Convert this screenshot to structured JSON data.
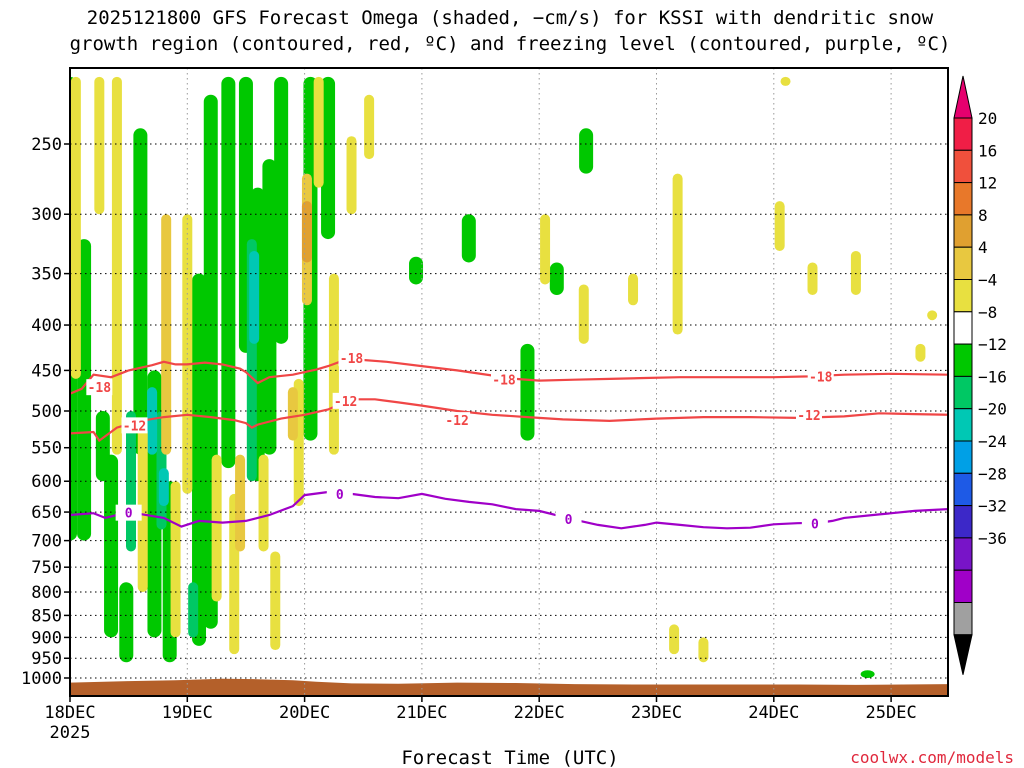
{
  "chart_data": {
    "type": "contour",
    "title_line1": "2025121800 GFS Forecast Omega (shaded, −cm/s) for KSSI with dendritic snow",
    "title_line2": "growth region (contoured, red, ºC) and freezing level (contoured, purple, ºC)",
    "xlabel": "Forecast Time (UTC)",
    "ylabel": "",
    "credit": "coolwx.com/models",
    "x_unit": "days since 18DEC 2025 00Z",
    "xlim": [
      0,
      7.49
    ],
    "x_ticks": [
      {
        "x": 0,
        "label": "18DEC",
        "sub": "2025"
      },
      {
        "x": 1,
        "label": "19DEC"
      },
      {
        "x": 2,
        "label": "20DEC"
      },
      {
        "x": 3,
        "label": "21DEC"
      },
      {
        "x": 4,
        "label": "22DEC"
      },
      {
        "x": 5,
        "label": "23DEC"
      },
      {
        "x": 6,
        "label": "24DEC"
      },
      {
        "x": 7,
        "label": "25DEC"
      }
    ],
    "y_scale": "log-pressure",
    "ylim_hpa": [
      207,
      1035
    ],
    "y_ticks": [
      250,
      300,
      350,
      400,
      450,
      500,
      550,
      600,
      650,
      700,
      750,
      800,
      850,
      900,
      950,
      1000
    ],
    "grid": true,
    "colorbar": {
      "labels": [
        "20",
        "16",
        "12",
        "8",
        "4",
        "−4",
        "−8",
        "−12",
        "−16",
        "−20",
        "−24",
        "−28",
        "−32",
        "−36"
      ],
      "bins": [
        "#f01e46",
        "#f0503c",
        "#e8782a",
        "#e0a030",
        "#e8c840",
        "#e8e040",
        "#ffffff",
        "#00c800",
        "#00c864",
        "#00c8b4",
        "#00a0e6",
        "#1e5ae6",
        "#3c28c8",
        "#7814c8",
        "#a000c8",
        "#a0a0a0"
      ],
      "top_color": "#e6006e",
      "bottom_color": "#000000"
    },
    "series": [
      {
        "label": "-18",
        "color": "#f04646",
        "points": [
          [
            0,
            478
          ],
          [
            0.1,
            472
          ],
          [
            0.2,
            455
          ],
          [
            0.35,
            458
          ],
          [
            0.5,
            450
          ],
          [
            0.7,
            444
          ],
          [
            0.8,
            440
          ],
          [
            0.9,
            443
          ],
          [
            1.0,
            443
          ],
          [
            1.15,
            441
          ],
          [
            1.3,
            443
          ],
          [
            1.45,
            448
          ],
          [
            1.5,
            452
          ],
          [
            1.6,
            465
          ],
          [
            1.7,
            458
          ],
          [
            1.9,
            455
          ],
          [
            2.0,
            452
          ],
          [
            2.1,
            449
          ],
          [
            2.2,
            445
          ],
          [
            2.3,
            440
          ],
          [
            2.4,
            437
          ],
          [
            2.5,
            438
          ],
          [
            2.7,
            440
          ],
          [
            3.0,
            445
          ],
          [
            3.3,
            450
          ],
          [
            3.6,
            456
          ],
          [
            3.8,
            460
          ],
          [
            4.0,
            462
          ],
          [
            4.3,
            461
          ],
          [
            4.6,
            460
          ],
          [
            4.9,
            459
          ],
          [
            5.2,
            458
          ],
          [
            5.5,
            458
          ],
          [
            6.0,
            458
          ],
          [
            6.3,
            457
          ],
          [
            6.6,
            455
          ],
          [
            7.0,
            454
          ],
          [
            7.49,
            455
          ]
        ],
        "label_positions": [
          [
            0.25,
            470
          ],
          [
            2.4,
            436
          ],
          [
            3.7,
            461
          ],
          [
            6.4,
            457
          ]
        ]
      },
      {
        "label": "-12",
        "color": "#f04646",
        "points": [
          [
            0,
            530
          ],
          [
            0.2,
            528
          ],
          [
            0.25,
            540
          ],
          [
            0.4,
            522
          ],
          [
            0.6,
            513
          ],
          [
            0.8,
            508
          ],
          [
            1.0,
            505
          ],
          [
            1.2,
            508
          ],
          [
            1.4,
            512
          ],
          [
            1.5,
            516
          ],
          [
            1.55,
            522
          ],
          [
            1.6,
            518
          ],
          [
            1.8,
            510
          ],
          [
            2.0,
            505
          ],
          [
            2.2,
            498
          ],
          [
            2.4,
            485
          ],
          [
            2.6,
            485
          ],
          [
            2.8,
            489
          ],
          [
            3.0,
            493
          ],
          [
            3.3,
            500
          ],
          [
            3.6,
            505
          ],
          [
            3.9,
            508
          ],
          [
            4.2,
            511
          ],
          [
            4.4,
            512
          ],
          [
            4.6,
            513
          ],
          [
            5.0,
            510
          ],
          [
            5.4,
            508
          ],
          [
            5.8,
            508
          ],
          [
            6.2,
            509
          ],
          [
            6.6,
            507
          ],
          [
            6.9,
            503
          ],
          [
            7.2,
            504
          ],
          [
            7.49,
            505
          ]
        ],
        "label_positions": [
          [
            0.55,
            519
          ],
          [
            2.35,
            487
          ],
          [
            3.3,
            512
          ],
          [
            6.3,
            505
          ]
        ]
      },
      {
        "label": "0",
        "color": "#a000c8",
        "points": [
          [
            0,
            655
          ],
          [
            0.2,
            652
          ],
          [
            0.3,
            660
          ],
          [
            0.5,
            650
          ],
          [
            0.8,
            660
          ],
          [
            0.95,
            675
          ],
          [
            1.1,
            665
          ],
          [
            1.3,
            668
          ],
          [
            1.5,
            665
          ],
          [
            1.7,
            655
          ],
          [
            1.9,
            640
          ],
          [
            2.0,
            622
          ],
          [
            2.2,
            617
          ],
          [
            2.4,
            620
          ],
          [
            2.6,
            625
          ],
          [
            2.8,
            627
          ],
          [
            3.0,
            620
          ],
          [
            3.2,
            628
          ],
          [
            3.4,
            633
          ],
          [
            3.6,
            637
          ],
          [
            3.8,
            645
          ],
          [
            4.0,
            648
          ],
          [
            4.3,
            663
          ],
          [
            4.5,
            672
          ],
          [
            4.7,
            678
          ],
          [
            4.9,
            672
          ],
          [
            5.0,
            668
          ],
          [
            5.2,
            672
          ],
          [
            5.4,
            676
          ],
          [
            5.6,
            678
          ],
          [
            5.8,
            677
          ],
          [
            6.0,
            671
          ],
          [
            6.2,
            669
          ],
          [
            6.4,
            668
          ],
          [
            6.5,
            665
          ],
          [
            6.6,
            660
          ],
          [
            6.9,
            654
          ],
          [
            7.2,
            648
          ],
          [
            7.49,
            645
          ]
        ],
        "label_positions": [
          [
            0.5,
            651
          ],
          [
            2.3,
            620
          ],
          [
            4.25,
            662
          ],
          [
            6.35,
            670
          ]
        ]
      }
    ],
    "shaded_regions": [
      {
        "bin": "-8",
        "x": 0.0,
        "p0": 210,
        "p1": 700
      },
      {
        "bin": "-8",
        "x": 0.12,
        "p0": 320,
        "p1": 700
      },
      {
        "bin": "-8",
        "x": 0.35,
        "p0": 560,
        "p1": 900
      },
      {
        "bin": "-8",
        "x": 0.48,
        "p0": 780,
        "p1": 960
      },
      {
        "bin": "-8",
        "x": 0.6,
        "p0": 240,
        "p1": 560
      },
      {
        "bin": "-8",
        "x": 0.72,
        "p0": 450,
        "p1": 900
      },
      {
        "bin": "-8",
        "x": 0.85,
        "p0": 600,
        "p1": 960
      },
      {
        "bin": "-8",
        "x": 1.1,
        "p0": 350,
        "p1": 920
      },
      {
        "bin": "-8",
        "x": 1.2,
        "p0": 220,
        "p1": 880
      },
      {
        "bin": "-8",
        "x": 1.35,
        "p0": 210,
        "p1": 580
      },
      {
        "bin": "-8",
        "x": 1.5,
        "p0": 210,
        "p1": 430
      },
      {
        "bin": "-8",
        "x": 1.6,
        "p0": 280,
        "p1": 600
      },
      {
        "bin": "-8",
        "x": 1.7,
        "p0": 260,
        "p1": 560
      },
      {
        "bin": "-8",
        "x": 1.8,
        "p0": 210,
        "p1": 420
      },
      {
        "bin": "-8",
        "x": 2.05,
        "p0": 210,
        "p1": 540
      },
      {
        "bin": "-8",
        "x": 2.2,
        "p0": 210,
        "p1": 320
      },
      {
        "bin": "-8",
        "x": 0.28,
        "p0": 500,
        "p1": 600
      },
      {
        "bin": "-8",
        "x": 3.9,
        "p0": 420,
        "p1": 540
      },
      {
        "bin": "-8",
        "x": 3.4,
        "p0": 300,
        "p1": 340
      },
      {
        "bin": "-8",
        "x": 2.95,
        "p0": 335,
        "p1": 360
      },
      {
        "bin": "-8",
        "x": 4.15,
        "p0": 340,
        "p1": 370
      },
      {
        "bin": "-8",
        "x": 4.4,
        "p0": 240,
        "p1": 270
      },
      {
        "bin": "-8",
        "x": 6.8,
        "p0": 980,
        "p1": 1000
      },
      {
        "bin": "-12",
        "x": 0.02,
        "p0": 300,
        "p1": 420
      },
      {
        "bin": "-12",
        "x": 0.52,
        "p0": 500,
        "p1": 720
      },
      {
        "bin": "-12",
        "x": 0.78,
        "p0": 500,
        "p1": 680
      },
      {
        "bin": "-12",
        "x": 1.05,
        "p0": 780,
        "p1": 900
      },
      {
        "bin": "-12",
        "x": 1.55,
        "p0": 320,
        "p1": 600
      },
      {
        "bin": "-16",
        "x": 0.7,
        "p0": 470,
        "p1": 560
      },
      {
        "bin": "-16",
        "x": 0.8,
        "p0": 580,
        "p1": 640
      },
      {
        "bin": "-16",
        "x": 1.57,
        "p0": 330,
        "p1": 420
      },
      {
        "bin": "4",
        "x": 0.05,
        "p0": 210,
        "p1": 460
      },
      {
        "bin": "4",
        "x": 0.25,
        "p0": 210,
        "p1": 300
      },
      {
        "bin": "4",
        "x": 0.4,
        "p0": 210,
        "p1": 560
      },
      {
        "bin": "4",
        "x": 0.62,
        "p0": 520,
        "p1": 800
      },
      {
        "bin": "4",
        "x": 0.9,
        "p0": 600,
        "p1": 900
      },
      {
        "bin": "4",
        "x": 1.0,
        "p0": 300,
        "p1": 620
      },
      {
        "bin": "4",
        "x": 1.25,
        "p0": 560,
        "p1": 820
      },
      {
        "bin": "4",
        "x": 1.4,
        "p0": 620,
        "p1": 940
      },
      {
        "bin": "4",
        "x": 1.65,
        "p0": 560,
        "p1": 720
      },
      {
        "bin": "4",
        "x": 1.75,
        "p0": 720,
        "p1": 930
      },
      {
        "bin": "4",
        "x": 1.95,
        "p0": 460,
        "p1": 640
      },
      {
        "bin": "4",
        "x": 2.12,
        "p0": 210,
        "p1": 280
      },
      {
        "bin": "4",
        "x": 2.25,
        "p0": 350,
        "p1": 560
      },
      {
        "bin": "4",
        "x": 2.4,
        "p0": 245,
        "p1": 300
      },
      {
        "bin": "4",
        "x": 2.55,
        "p0": 220,
        "p1": 260
      },
      {
        "bin": "4",
        "x": 4.05,
        "p0": 300,
        "p1": 360
      },
      {
        "bin": "4",
        "x": 4.38,
        "p0": 360,
        "p1": 420
      },
      {
        "bin": "4",
        "x": 4.8,
        "p0": 350,
        "p1": 380
      },
      {
        "bin": "4",
        "x": 5.18,
        "p0": 270,
        "p1": 410
      },
      {
        "bin": "4",
        "x": 6.05,
        "p0": 290,
        "p1": 330
      },
      {
        "bin": "4",
        "x": 6.33,
        "p0": 340,
        "p1": 370
      },
      {
        "bin": "4",
        "x": 6.7,
        "p0": 330,
        "p1": 370
      },
      {
        "bin": "4",
        "x": 7.35,
        "p0": 385,
        "p1": 395
      },
      {
        "bin": "4",
        "x": 7.25,
        "p0": 420,
        "p1": 440
      },
      {
        "bin": "4",
        "x": 5.15,
        "p0": 870,
        "p1": 940
      },
      {
        "bin": "4",
        "x": 5.4,
        "p0": 900,
        "p1": 960
      },
      {
        "bin": "4",
        "x": 6.1,
        "p0": 210,
        "p1": 215
      },
      {
        "bin": "8",
        "x": 0.82,
        "p0": 300,
        "p1": 560
      },
      {
        "bin": "8",
        "x": 1.45,
        "p0": 560,
        "p1": 720
      },
      {
        "bin": "8",
        "x": 2.02,
        "p0": 270,
        "p1": 380
      },
      {
        "bin": "8",
        "x": 1.9,
        "p0": 470,
        "p1": 540
      },
      {
        "bin": "12",
        "x": 2.02,
        "p0": 290,
        "p1": 340
      }
    ],
    "surface": {
      "color": "#b4602a",
      "points": [
        [
          0,
          1012
        ],
        [
          0.5,
          1008
        ],
        [
          0.9,
          1006
        ],
        [
          1.3,
          1002
        ],
        [
          1.6,
          1003
        ],
        [
          1.9,
          1006
        ],
        [
          2.1,
          1010
        ],
        [
          2.4,
          1014
        ],
        [
          2.8,
          1015
        ],
        [
          3.3,
          1012
        ],
        [
          3.8,
          1013
        ],
        [
          4.3,
          1016
        ],
        [
          4.8,
          1017
        ],
        [
          5.5,
          1017
        ],
        [
          6.2,
          1017
        ],
        [
          6.7,
          1018
        ],
        [
          7.1,
          1017
        ],
        [
          7.49,
          1016
        ]
      ]
    }
  }
}
